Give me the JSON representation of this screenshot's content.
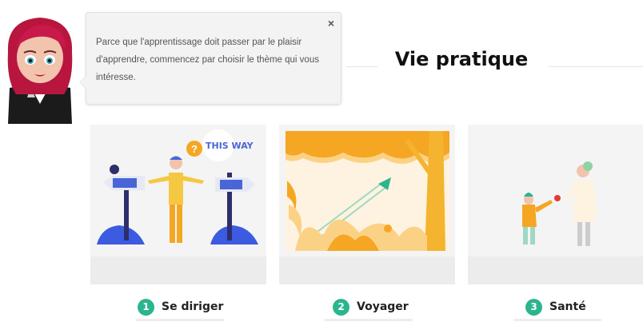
{
  "bubble": {
    "text": "Parce que l'apprentissage doit passer par le plaisir d'apprendre, commencez par choisir le thème qui vous intéresse.",
    "close_icon": "×"
  },
  "page_title": "Vie pratique",
  "cards": [
    {
      "number": "1",
      "label": "Se diriger",
      "sign_text": "THIS WAY",
      "question": "?"
    },
    {
      "number": "2",
      "label": "Voyager"
    },
    {
      "number": "3",
      "label": "Santé"
    }
  ],
  "colors": {
    "accent": "#2bb58f",
    "sign_blue": "#4a66d6",
    "orange": "#f5a623"
  }
}
